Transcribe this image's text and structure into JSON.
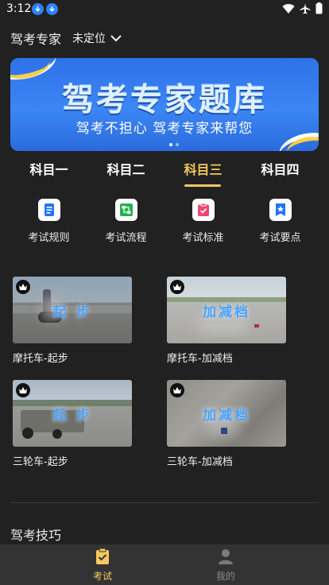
{
  "status_bar": {
    "time": "3:12"
  },
  "header": {
    "app_title": "驾考专家",
    "location": "未定位"
  },
  "banner": {
    "title": "驾考专家题库",
    "subtitle": "驾考不担心 驾考专家来帮您"
  },
  "tabs": [
    {
      "label": "科目一"
    },
    {
      "label": "科目二"
    },
    {
      "label": "科目三",
      "active": true
    },
    {
      "label": "科目四"
    }
  ],
  "features": [
    {
      "label": "考试规则",
      "icon": "document-icon"
    },
    {
      "label": "考试流程",
      "icon": "flowchart-icon"
    },
    {
      "label": "考试标准",
      "icon": "clipboard-check-icon"
    },
    {
      "label": "考试要点",
      "icon": "bookmark-star-icon"
    }
  ],
  "videos": [
    {
      "title": "摩托车-起步",
      "overlay": "起 步"
    },
    {
      "title": "摩托车-加减档",
      "overlay": "加减档"
    },
    {
      "title": "三轮车-起步",
      "overlay": "起 步"
    },
    {
      "title": "三轮车-加减档",
      "overlay": "加减档"
    }
  ],
  "section": {
    "title": "驾考技巧"
  },
  "bottom_nav": [
    {
      "label": "考试",
      "active": true
    },
    {
      "label": "我的",
      "active": false
    }
  ],
  "colors": {
    "accent": "#f5c85f",
    "background": "#212121",
    "nav": "#333333",
    "banner": "#3c86f5"
  }
}
